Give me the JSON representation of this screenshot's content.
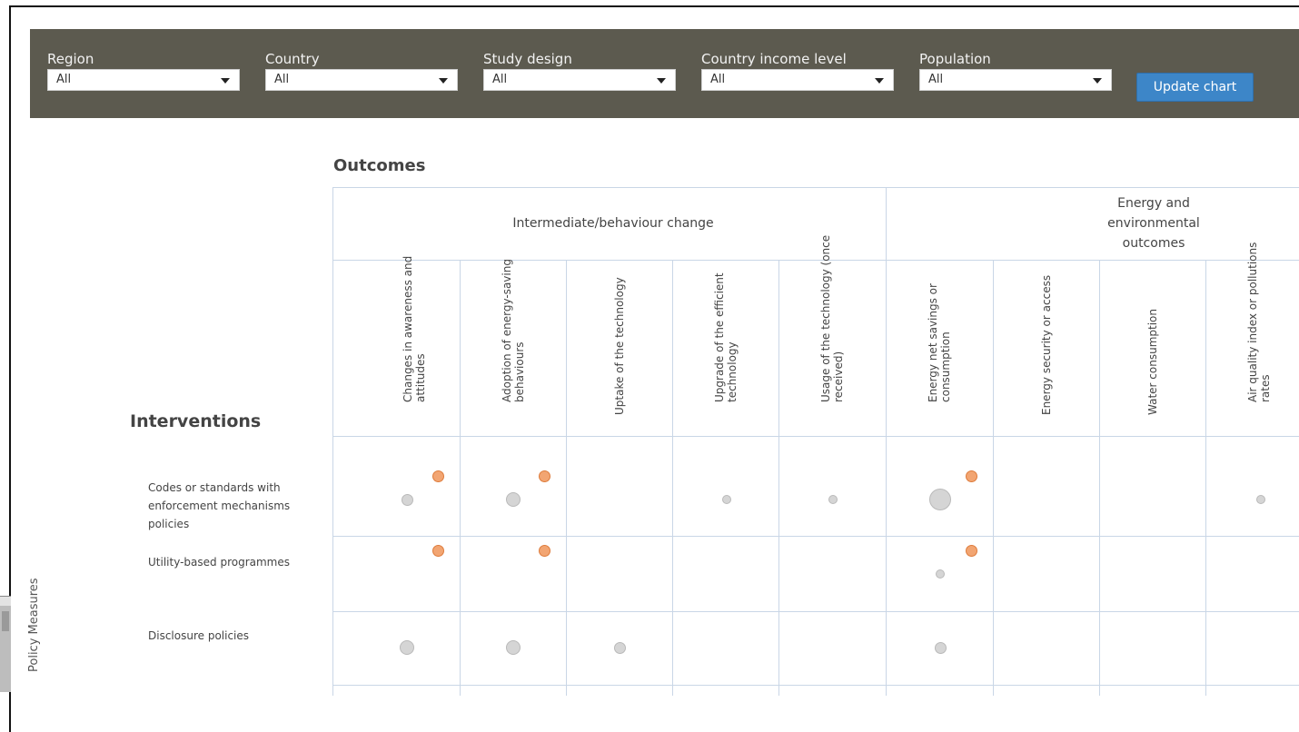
{
  "filters": [
    {
      "label": "Region",
      "value": "All"
    },
    {
      "label": "Country",
      "value": "All"
    },
    {
      "label": "Study design",
      "value": "All"
    },
    {
      "label": "Country income level",
      "value": "All"
    },
    {
      "label": "Population",
      "value": "All"
    }
  ],
  "update_button": "Update chart",
  "outcomes_heading": "Outcomes",
  "interventions_heading": "Interventions",
  "side_label": "Policy Measures",
  "outcome_groups": [
    {
      "label": "Intermediate/behaviour change"
    },
    {
      "label": "Energy and environmental outcomes"
    }
  ],
  "columns": [
    "Changes in awareness and attitudes",
    "Adoption of energy-saving behaviours",
    "Uptake of the technology",
    "Upgrade of the efficient technology",
    "Usage of the technology (once received)",
    "Energy net savings or consumption",
    "Energy security or access",
    "Water consumption",
    "Air quality index or pollutions rates"
  ],
  "rows": [
    "Codes or standards with enforcement mechanisms policies",
    "Utility-based programmes",
    "Disclosure policies"
  ],
  "colors": {
    "bar": "#5c5a4f",
    "button": "#3d86c8",
    "grey_marker": "#d5d5d5",
    "orange_marker": "#f2a572",
    "grid": "#c9d6e6"
  },
  "markers": [
    {
      "row": 0,
      "col": 0,
      "type": "grey",
      "size": "small"
    },
    {
      "row": 0,
      "col": 0,
      "type": "orange",
      "size": "small"
    },
    {
      "row": 0,
      "col": 1,
      "type": "grey",
      "size": "medium"
    },
    {
      "row": 0,
      "col": 1,
      "type": "orange",
      "size": "small"
    },
    {
      "row": 0,
      "col": 3,
      "type": "grey",
      "size": "xsmall"
    },
    {
      "row": 0,
      "col": 4,
      "type": "grey",
      "size": "xsmall"
    },
    {
      "row": 0,
      "col": 5,
      "type": "grey",
      "size": "large"
    },
    {
      "row": 0,
      "col": 5,
      "type": "orange",
      "size": "small"
    },
    {
      "row": 0,
      "col": 8,
      "type": "grey",
      "size": "xsmall"
    },
    {
      "row": 1,
      "col": 0,
      "type": "orange",
      "size": "small"
    },
    {
      "row": 1,
      "col": 1,
      "type": "orange",
      "size": "small"
    },
    {
      "row": 1,
      "col": 5,
      "type": "grey",
      "size": "xsmall"
    },
    {
      "row": 1,
      "col": 5,
      "type": "orange",
      "size": "small"
    },
    {
      "row": 2,
      "col": 0,
      "type": "grey",
      "size": "medium"
    },
    {
      "row": 2,
      "col": 1,
      "type": "grey",
      "size": "medium"
    },
    {
      "row": 2,
      "col": 2,
      "type": "grey",
      "size": "small"
    },
    {
      "row": 2,
      "col": 5,
      "type": "grey",
      "size": "small"
    }
  ]
}
